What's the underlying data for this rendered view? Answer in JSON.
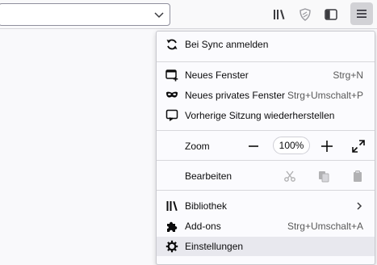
{
  "menu": {
    "sync": "Bei Sync anmelden",
    "new_window": {
      "label": "Neues Fenster",
      "shortcut": "Strg+N"
    },
    "private_window": {
      "label": "Neues privates Fenster",
      "shortcut": "Strg+Umschalt+P"
    },
    "restore_session": "Vorherige Sitzung wiederherstellen",
    "zoom": {
      "label": "Zoom",
      "value": "100%"
    },
    "edit": "Bearbeiten",
    "library": "Bibliothek",
    "addons": {
      "label": "Add-ons",
      "shortcut": "Strg+Umschalt+A"
    },
    "settings": "Einstellungen"
  },
  "colors": {
    "hover_bg": "#e8e8ee",
    "active_button_bg": "#d2d2d6",
    "disabled_icon": "#b1b1b3"
  },
  "icons": [
    "chevron-down-icon",
    "library-icon",
    "shield-icon",
    "sidebar-icon",
    "hamburger-menu-icon",
    "sync-icon",
    "new-window-icon",
    "private-mask-icon",
    "restore-session-icon",
    "zoom-out-icon",
    "zoom-in-icon",
    "fullscreen-icon",
    "cut-icon",
    "copy-icon",
    "paste-icon",
    "chevron-right-icon",
    "puzzle-icon",
    "gear-icon"
  ]
}
